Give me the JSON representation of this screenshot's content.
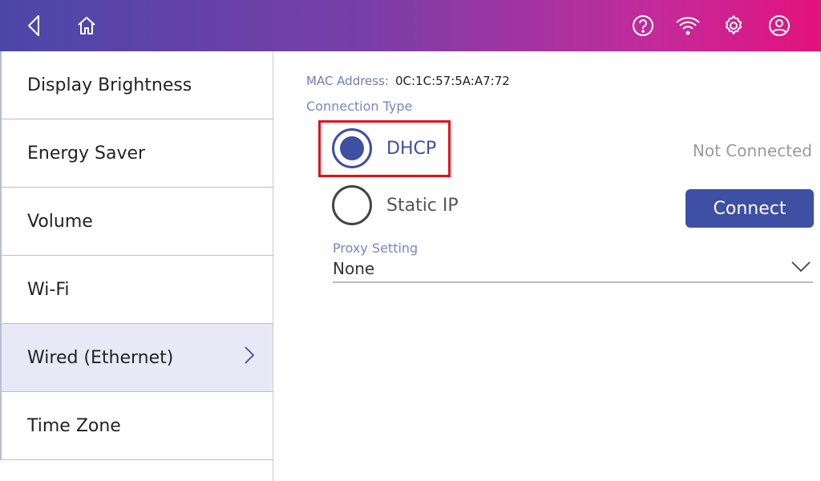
{
  "header": {
    "icons": [
      "back-icon",
      "home-icon",
      "help-icon",
      "wifi-icon",
      "gear-icon",
      "account-icon"
    ]
  },
  "sidebar": {
    "items": [
      {
        "label": "Display Brightness"
      },
      {
        "label": "Energy Saver"
      },
      {
        "label": "Volume"
      },
      {
        "label": "Wi-Fi"
      },
      {
        "label": "Wired (Ethernet)",
        "active": true
      },
      {
        "label": "Time Zone"
      }
    ]
  },
  "main": {
    "mac_label": "MAC Address:",
    "mac_value": "0C:1C:57:5A:A7:72",
    "connection_type_label": "Connection Type",
    "options": [
      {
        "label": "DHCP",
        "selected": true
      },
      {
        "label": "Static IP",
        "selected": false
      }
    ],
    "status": "Not Connected",
    "connect_label": "Connect",
    "proxy_label": "Proxy Setting",
    "proxy_value": "None"
  },
  "colors": {
    "accent": "#3f4fa3",
    "highlight": "#e0131b",
    "label_blue": "#7886bf",
    "active_row": "#e8e9f6"
  }
}
